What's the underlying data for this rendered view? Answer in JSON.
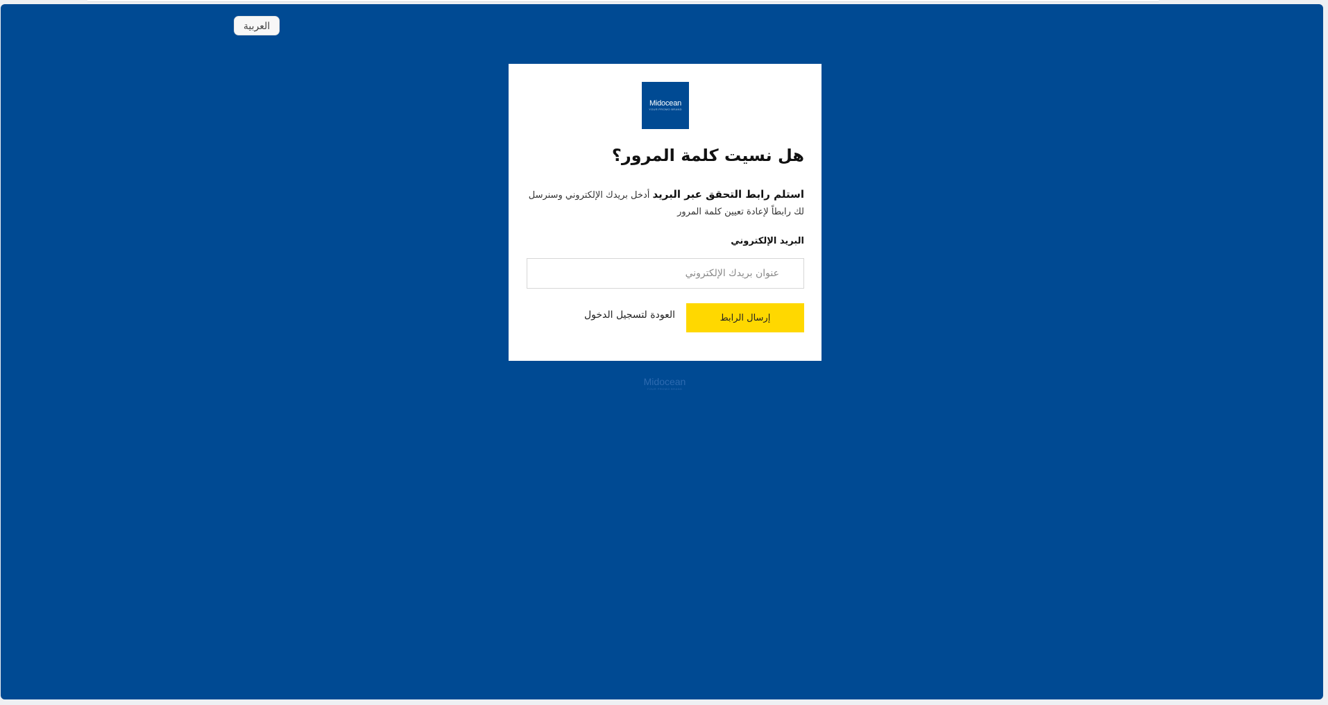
{
  "page": {
    "background_color": "#004a93",
    "accent_color": "#ffd800"
  },
  "language_button": {
    "label": "العربية"
  },
  "logo": {
    "name": "Midocean",
    "tagline": "YOUR PROMO BRAND"
  },
  "form": {
    "title": "هل نسيت كلمة المرور؟",
    "description_strong": "استلم رابط التحقق عبر البريد",
    "description": "أدخل بريدك الإلكتروني وسنرسل لك رابطاً لإعادة تعيين كلمة المرور",
    "email_label": "البريد الإلكتروني",
    "email_placeholder": "عنوان بريدك الإلكتروني",
    "email_value": "",
    "send_button": "إرسال الرابط",
    "back_link": "العودة لتسجيل الدخول"
  },
  "footer": {
    "brand": "Midocean",
    "tagline": "YOUR PROMO BRAND"
  }
}
